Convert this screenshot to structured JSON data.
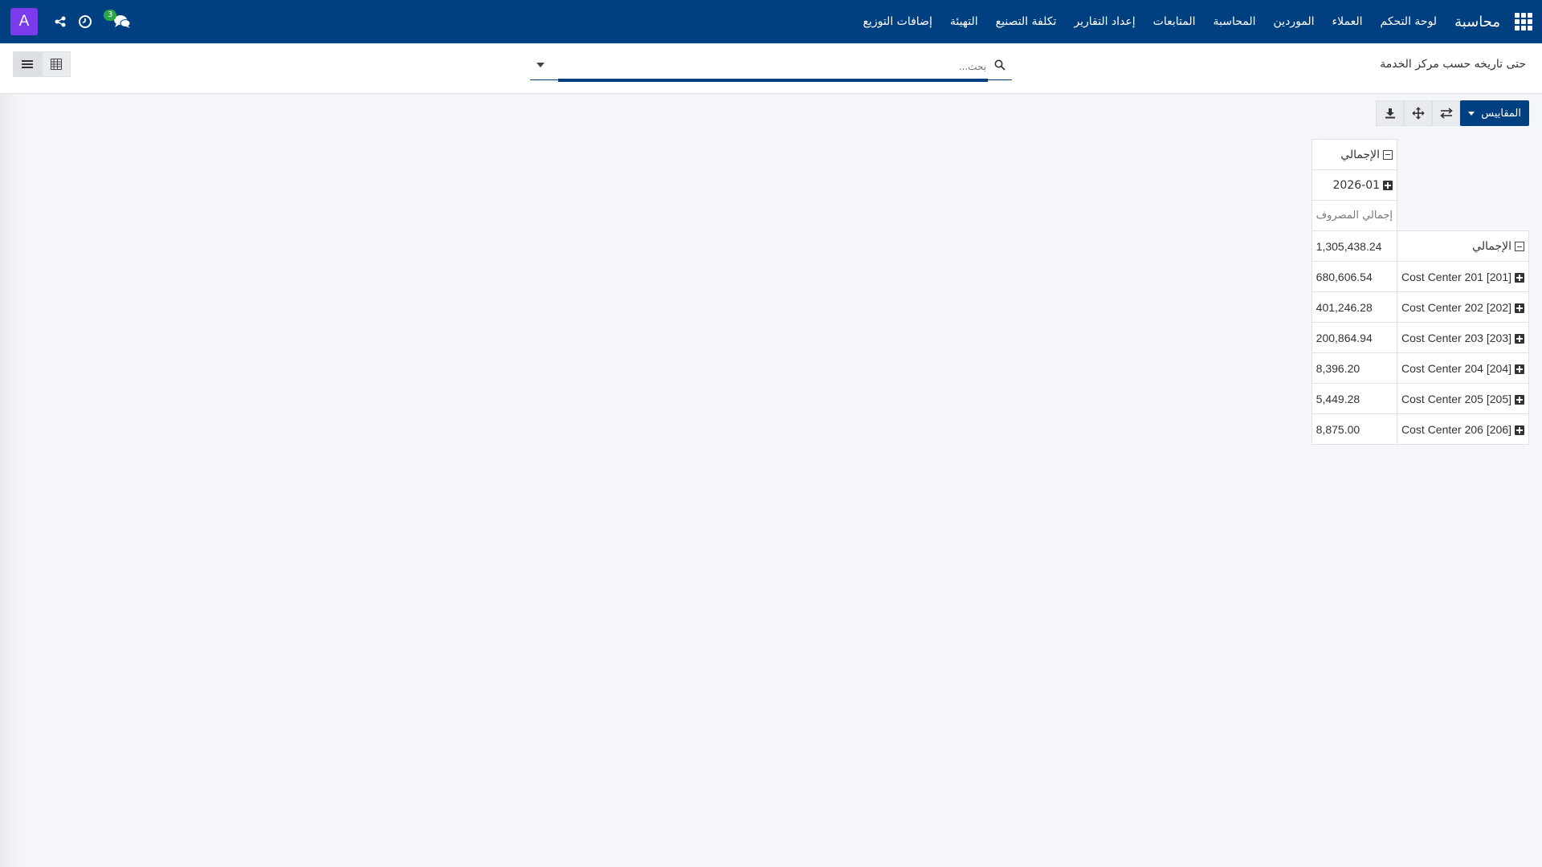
{
  "navbar": {
    "brand": "محاسبة",
    "menu": [
      "لوحة التحكم",
      "العملاء",
      "الموردين",
      "المحاسبة",
      "المتابعات",
      "إعداد التقارير",
      "تكلفة التصنيع",
      "التهيئة",
      "إضافات التوزيع"
    ],
    "chat_badge": "3",
    "avatar_letter": "A"
  },
  "control_panel": {
    "breadcrumb": "حتى تاريخه حسب مركز الخدمة",
    "search_placeholder": "بحث..."
  },
  "toolbar": {
    "measures_label": "المقاييس"
  },
  "pivot": {
    "col_total": "الإجمالي",
    "col_period": "2026-01",
    "measure": "إجمالي المصروف",
    "row_total_label": "الإجمالي",
    "row_total_value": "1,305,438.24",
    "rows": [
      {
        "label": "[201] Cost Center 201",
        "value": "680,606.54"
      },
      {
        "label": "[202] Cost Center 202",
        "value": "401,246.28"
      },
      {
        "label": "[203] Cost Center 203",
        "value": "200,864.94"
      },
      {
        "label": "[204] Cost Center 204",
        "value": "8,396.20"
      },
      {
        "label": "[205] Cost Center 205",
        "value": "5,449.28"
      },
      {
        "label": "[206] Cost Center 206",
        "value": "8,875.00"
      }
    ]
  },
  "colors": {
    "navbar": "#004080",
    "avatar": "#7c3aed",
    "badge": "#28a745"
  }
}
